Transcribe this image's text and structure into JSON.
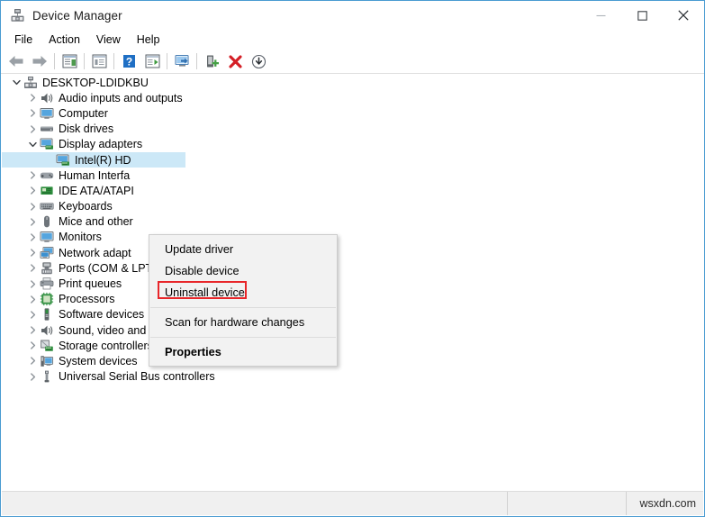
{
  "window": {
    "title": "Device Manager",
    "icon": "device-manager-icon",
    "controls": {
      "minimize": "minimize-icon",
      "maximize": "maximize-icon",
      "close": "close-icon"
    }
  },
  "menubar": {
    "items": [
      {
        "label": "File"
      },
      {
        "label": "Action"
      },
      {
        "label": "View"
      },
      {
        "label": "Help"
      }
    ]
  },
  "toolbar": {
    "buttons": [
      {
        "name": "back-icon"
      },
      {
        "name": "forward-icon"
      },
      {
        "name": "show-hide-console-tree-icon"
      },
      {
        "name": "properties-icon"
      },
      {
        "name": "help-icon"
      },
      {
        "name": "scan-hardware-changes-icon"
      },
      {
        "name": "update-driver-icon"
      },
      {
        "name": "add-legacy-hardware-icon"
      },
      {
        "name": "uninstall-device-icon"
      },
      {
        "name": "disable-device-icon"
      }
    ]
  },
  "tree": {
    "root": {
      "label": "DESKTOP-LDIDKBU",
      "icon": "computer-root-icon",
      "expanded": true
    },
    "nodes": [
      {
        "label": "Audio inputs and outputs",
        "icon": "speaker-icon",
        "expanded": false,
        "level": 1
      },
      {
        "label": "Computer",
        "icon": "monitor-icon",
        "expanded": false,
        "level": 1
      },
      {
        "label": "Disk drives",
        "icon": "disk-icon",
        "expanded": false,
        "level": 1
      },
      {
        "label": "Display adapters",
        "icon": "display-adapter-icon",
        "expanded": true,
        "level": 1
      },
      {
        "label": "Intel(R) HD",
        "icon": "display-adapter-icon",
        "expanded": null,
        "level": 2,
        "selected": true
      },
      {
        "label": "Human Interfa",
        "icon": "hid-icon",
        "expanded": false,
        "level": 1
      },
      {
        "label": "IDE ATA/ATAPI",
        "icon": "ide-controller-icon",
        "expanded": false,
        "level": 1
      },
      {
        "label": "Keyboards",
        "icon": "keyboard-icon",
        "expanded": false,
        "level": 1
      },
      {
        "label": "Mice and other",
        "icon": "mouse-icon",
        "expanded": false,
        "level": 1
      },
      {
        "label": "Monitors",
        "icon": "monitor-icon",
        "expanded": false,
        "level": 1
      },
      {
        "label": "Network adapt",
        "icon": "network-adapter-icon",
        "expanded": false,
        "level": 1
      },
      {
        "label": "Ports (COM & LPT)",
        "icon": "port-icon",
        "expanded": false,
        "level": 1
      },
      {
        "label": "Print queues",
        "icon": "printer-icon",
        "expanded": false,
        "level": 1
      },
      {
        "label": "Processors",
        "icon": "processor-icon",
        "expanded": false,
        "level": 1
      },
      {
        "label": "Software devices",
        "icon": "software-device-icon",
        "expanded": false,
        "level": 1
      },
      {
        "label": "Sound, video and game controllers",
        "icon": "speaker-icon",
        "expanded": false,
        "level": 1
      },
      {
        "label": "Storage controllers",
        "icon": "storage-controller-icon",
        "expanded": false,
        "level": 1
      },
      {
        "label": "System devices",
        "icon": "system-device-icon",
        "expanded": false,
        "level": 1
      },
      {
        "label": "Universal Serial Bus controllers",
        "icon": "usb-icon",
        "expanded": false,
        "level": 1
      }
    ]
  },
  "context_menu": {
    "items": [
      {
        "label": "Update driver",
        "bold": false,
        "highlighted": false
      },
      {
        "label": "Disable device",
        "bold": false,
        "highlighted": false
      },
      {
        "label": "Uninstall device",
        "bold": false,
        "highlighted": true
      },
      {
        "label": "Scan for hardware changes",
        "bold": false,
        "highlighted": false
      },
      {
        "label": "Properties",
        "bold": true,
        "highlighted": false
      }
    ],
    "highlight_color": "#e8262a"
  },
  "statusbar": {
    "main": "",
    "mid": "",
    "watermark": "wsxdn.com"
  },
  "colors": {
    "window_border": "#4a9bd1",
    "selection": "#cce8f7",
    "menu_bg": "#f2f2f2",
    "status_bg": "#f0f0f0",
    "accent_red": "#e8262a"
  }
}
